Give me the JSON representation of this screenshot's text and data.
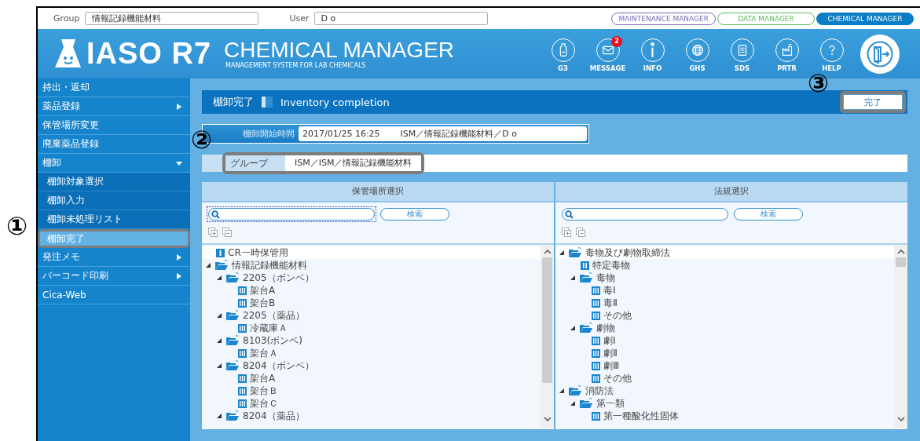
{
  "top_bar": {
    "group_label": "Group",
    "group_value": "情報記録機能材料",
    "user_label": "User",
    "user_value": "D o",
    "products": [
      {
        "label": "MAINTENANCE MANAGER",
        "color": "#7d6bb5",
        "selected": false
      },
      {
        "label": "DATA MANAGER",
        "color": "#5cb85c",
        "selected": false
      },
      {
        "label": "CHEMICAL MANAGER",
        "color": "#0b7cc6",
        "selected": true
      }
    ]
  },
  "header": {
    "logo": "IASO R7",
    "title": "CHEMICAL MANAGER",
    "subtitle": "MANAGEMENT SYSTEM FOR LAB CHEMICALS",
    "nav": [
      {
        "label": "G3",
        "kind": "bottle"
      },
      {
        "label": "MESSAGE",
        "kind": "mail",
        "badge": "2"
      },
      {
        "label": "INFO",
        "kind": "info"
      },
      {
        "label": "GHS",
        "kind": "globe"
      },
      {
        "label": "SDS",
        "kind": "document"
      },
      {
        "label": "PRTR",
        "kind": "factory"
      },
      {
        "label": "HELP",
        "kind": "question"
      }
    ]
  },
  "sidebar": {
    "items": [
      {
        "label": "持出・返却",
        "kind": "link",
        "selected": false
      },
      {
        "label": "薬品登録",
        "kind": "group",
        "expanded": false,
        "selected": false
      },
      {
        "label": "保管場所変更",
        "kind": "link",
        "selected": false
      },
      {
        "label": "廃棄薬品登録",
        "kind": "link",
        "selected": false
      },
      {
        "label": "棚卸",
        "kind": "group",
        "expanded": true,
        "selected": false,
        "children": [
          {
            "label": "棚卸対象選択",
            "selected": false
          },
          {
            "label": "棚卸入力",
            "selected": false
          },
          {
            "label": "棚卸未処理リスト",
            "selected": false
          },
          {
            "label": "棚卸完了",
            "selected": true,
            "highlighted": true
          }
        ]
      },
      {
        "label": "発注メモ",
        "kind": "group",
        "expanded": false,
        "selected": false
      },
      {
        "label": "バーコード印刷",
        "kind": "group",
        "expanded": false,
        "selected": false
      },
      {
        "label": "Cica-Web",
        "kind": "link",
        "selected": false
      }
    ]
  },
  "page": {
    "title": "棚卸完了",
    "title_en": "Inventory completion",
    "complete_button": {
      "label": "完了",
      "highlighted": true
    },
    "start_time": {
      "label": "棚卸開始時間",
      "value": "2017/01/25 16:25",
      "owner": "ISM／情報記録機能材料／D o"
    },
    "group": {
      "label": "グループ",
      "value": "ISM／ISM／情報記録機能材料",
      "highlighted": true
    }
  },
  "panels": [
    {
      "title": "保管場所選択",
      "search_button": "検索",
      "focused": true,
      "tree": [
        {
          "label": "CR一時保管用",
          "kind": "class1"
        },
        {
          "label": "情報記録機能材料",
          "kind": "folder",
          "expanded": true,
          "children": [
            {
              "label": "2205（ボンベ）",
              "kind": "folder",
              "expanded": true,
              "children": [
                {
                  "label": "架台A",
                  "kind": "class3"
                },
                {
                  "label": "架台B",
                  "kind": "class3"
                }
              ]
            },
            {
              "label": "2205（薬品）",
              "kind": "folder",
              "expanded": true,
              "children": [
                {
                  "label": "冷蔵庫Ａ",
                  "kind": "class3"
                }
              ]
            },
            {
              "label": "8103(ボンベ)",
              "kind": "folder",
              "expanded": true,
              "children": [
                {
                  "label": "架台Ａ",
                  "kind": "class3"
                }
              ]
            },
            {
              "label": "8204（ボンベ）",
              "kind": "folder",
              "expanded": true,
              "children": [
                {
                  "label": "架台A",
                  "kind": "class3"
                },
                {
                  "label": "架台Ｂ",
                  "kind": "class3"
                },
                {
                  "label": "架台Ｃ",
                  "kind": "class3"
                }
              ]
            },
            {
              "label": "8204（薬品）",
              "kind": "folder",
              "expanded": true
            }
          ]
        }
      ]
    },
    {
      "title": "法規選択",
      "search_button": "検索",
      "focused": false,
      "tree": [
        {
          "label": "毒物及び劇物取締法",
          "kind": "folder",
          "expanded": true,
          "children": [
            {
              "label": "特定毒物",
              "kind": "class2"
            },
            {
              "label": "毒物",
              "kind": "folder",
              "expanded": true,
              "children": [
                {
                  "label": "毒Ⅰ",
                  "kind": "class3"
                },
                {
                  "label": "毒Ⅱ",
                  "kind": "class3"
                },
                {
                  "label": "その他",
                  "kind": "class3"
                }
              ]
            },
            {
              "label": "劇物",
              "kind": "folder",
              "expanded": true,
              "children": [
                {
                  "label": "劇Ⅰ",
                  "kind": "class3"
                },
                {
                  "label": "劇Ⅱ",
                  "kind": "class3"
                },
                {
                  "label": "劇Ⅲ",
                  "kind": "class3"
                },
                {
                  "label": "その他",
                  "kind": "class3"
                }
              ]
            }
          ]
        },
        {
          "label": "消防法",
          "kind": "folder",
          "expanded": true,
          "children": [
            {
              "label": "第一類",
              "kind": "folder",
              "expanded": true,
              "children": [
                {
                  "label": "第一種酸化性固体",
                  "kind": "class3"
                }
              ]
            }
          ]
        }
      ]
    }
  ],
  "annotations": [
    {
      "label": "①"
    },
    {
      "label": "②"
    },
    {
      "label": "③"
    }
  ]
}
